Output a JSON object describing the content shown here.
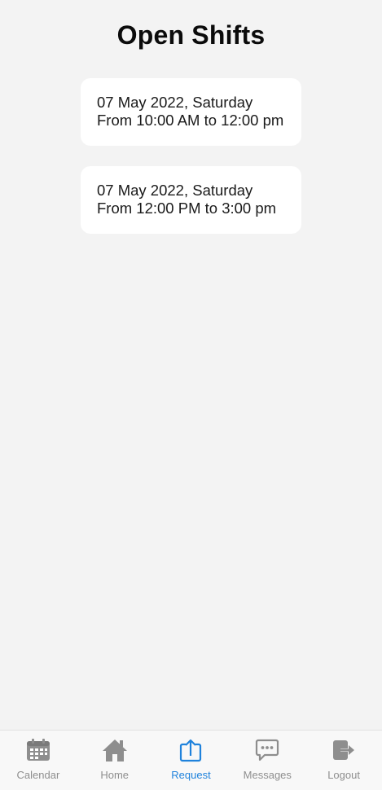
{
  "header": {
    "title": "Open Shifts"
  },
  "shifts": [
    {
      "date": "07 May 2022, Saturday",
      "time": "From 10:00 AM to 12:00 pm"
    },
    {
      "date": "07 May 2022, Saturday",
      "time": "From 12:00 PM to 3:00 pm"
    }
  ],
  "tabs": [
    {
      "label": "Calendar",
      "icon": "calendar-icon"
    },
    {
      "label": "Home",
      "icon": "home-icon"
    },
    {
      "label": "Request",
      "icon": "upload-request-icon",
      "active": true
    },
    {
      "label": "Messages",
      "icon": "message-icon"
    },
    {
      "label": "Logout",
      "icon": "logout-icon"
    }
  ],
  "colors": {
    "background": "#f3f3f3",
    "card": "#ffffff",
    "active_tab": "#1f82dc",
    "inactive_tab": "#8e8e8e"
  }
}
